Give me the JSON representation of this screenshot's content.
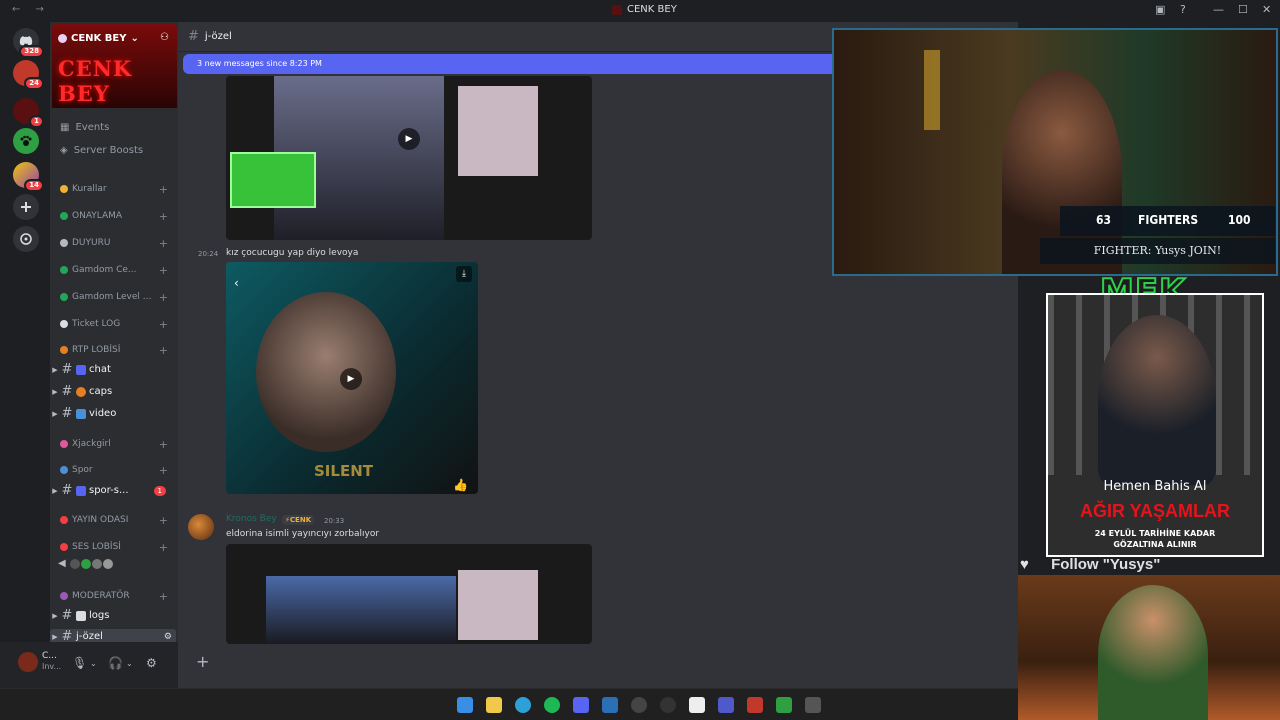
{
  "window": {
    "title": "CENK BEY",
    "nav_arrows": "← →",
    "controls": [
      "▣",
      "?",
      "—",
      "☐",
      "✕"
    ]
  },
  "servers": [
    {
      "name": "discord-home",
      "badge": "328",
      "color": "#5865f2"
    },
    {
      "name": "server-2",
      "badge": "24",
      "color": "#c0392b"
    },
    {
      "name": "server-3",
      "badge": "1",
      "color": "#8e1b1b"
    },
    {
      "name": "server-4",
      "badge": "",
      "color": "#2ea043"
    },
    {
      "name": "server-5",
      "badge": "14",
      "color": "#d35400"
    },
    {
      "name": "add-server",
      "badge": "",
      "color": "#313338"
    },
    {
      "name": "explore",
      "badge": "",
      "color": "#313338"
    }
  ],
  "sidebar": {
    "server_name": "CENK BEY",
    "banner_text": "CENK BEY",
    "events_label": "Events",
    "boosts_label": "Server Boosts",
    "categories": [
      {
        "label": "Kurallar",
        "color": "#f0b232"
      },
      {
        "label": "ONAYLAMA",
        "color": "#23a55a"
      },
      {
        "label": "DUYURU",
        "color": "#b5bac1"
      },
      {
        "label": "Gamdom Ce...",
        "color": "#23a55a"
      },
      {
        "label": "Gamdom Level ...",
        "color": "#23a55a"
      },
      {
        "label": "Ticket LOG",
        "color": "#dbdee1"
      },
      {
        "label": "RTP LOBİSİ",
        "color": "#e67e22"
      }
    ],
    "channels_a": [
      {
        "label": "chat",
        "emoji_color": "#5865f2",
        "badge": ""
      },
      {
        "label": "caps",
        "emoji_color": "#e67e22",
        "badge": ""
      },
      {
        "label": "video",
        "emoji_color": "#4a90d9",
        "badge": ""
      }
    ],
    "cat_xjackgirl": "Xjackgirl",
    "cat_spor": "Spor",
    "channel_spor": {
      "label": "spor-s...",
      "badge": "1"
    },
    "cat_yayin": "YAYIN ODASI",
    "cat_ses": "SES LOBİSİ",
    "cat_mod": "MODERATÖR",
    "channel_logs": "logs",
    "channel_ozel": "j-özel"
  },
  "user": {
    "name": "C...",
    "status": "Inv..."
  },
  "chat": {
    "channel_name": "j-özel",
    "new_messages": "3 new messages since 8:23 PM",
    "messages": [
      {
        "time": "20:24",
        "text": "kız çocucugu yap diyo levoya"
      },
      {
        "author": "Kronos Bey",
        "tag": "⚡CENK",
        "time": "20:33",
        "text": "eldorina isimli yayıncıyı zorbalıyor"
      }
    ]
  },
  "stream_overlay": {
    "left_num": "63",
    "fighters_label": "FIGHTERS",
    "right_num": "100",
    "join_text": "FIGHTER: Yusys JOIN!",
    "mfk_text": "MFK",
    "ad_hemen": "Hemen Bahis Al",
    "ad_title": "AĞIR YAŞAMLAR",
    "ad_sub1": "24 EYLÜL TARİHİNE KADAR",
    "ad_sub2": "GÖZALTINA ALINIR",
    "follow_text": "Follow \"Yusys\""
  },
  "video_overlay_text": "SILENT"
}
